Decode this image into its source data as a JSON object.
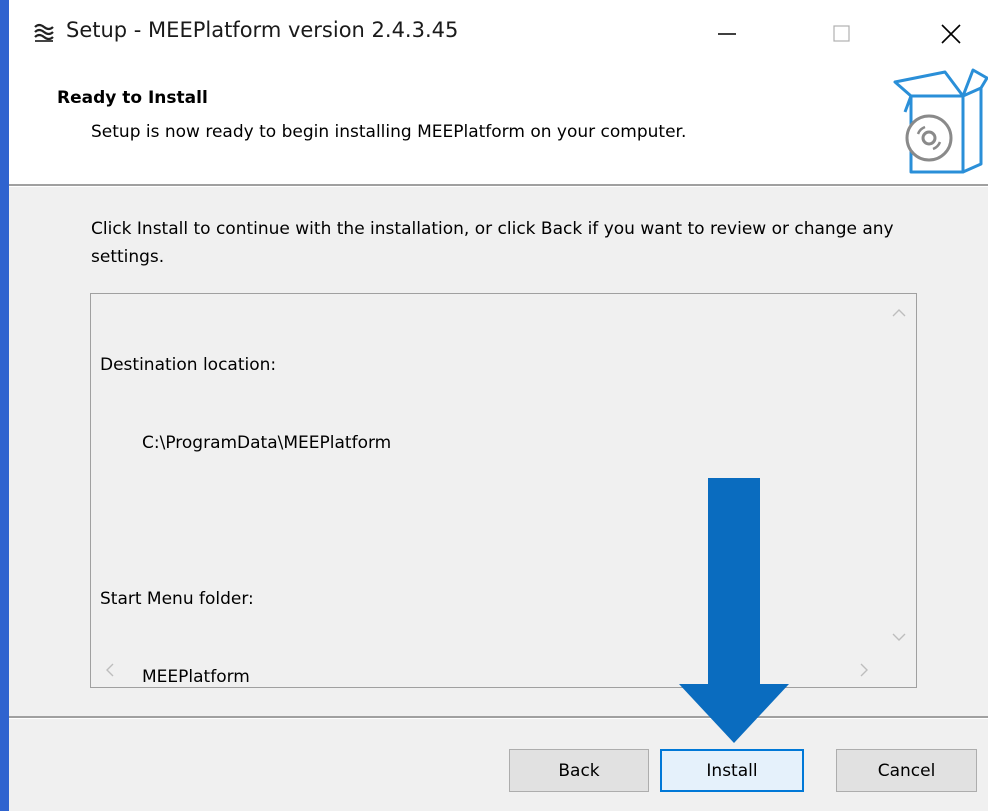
{
  "window": {
    "title": "Setup - MEEPlatform version 2.4.3.45",
    "app_icon": "meeplatform-logo-icon",
    "controls": [
      "minimize-icon",
      "maximize-icon",
      "close-icon"
    ]
  },
  "header": {
    "title": "Ready to Install",
    "subtitle": "Setup is now ready to begin installing MEEPlatform on your computer.",
    "icon": "software-box-icon"
  },
  "body": {
    "intro": "Click Install to continue with the installation, or click Back if you want to review or change any settings.",
    "memo": {
      "destination_label": "Destination location:",
      "destination_value": "C:\\ProgramData\\MEEPlatform",
      "start_menu_label": "Start Menu folder:",
      "start_menu_value": "MEEPlatform"
    }
  },
  "buttons": {
    "back": "Back",
    "install": "Install",
    "cancel": "Cancel"
  },
  "annotation": {
    "icon": "down-arrow-icon",
    "color": "#0a6cbf"
  },
  "colors": {
    "desktop": "#2f63cf",
    "accent": "#0078d7"
  }
}
